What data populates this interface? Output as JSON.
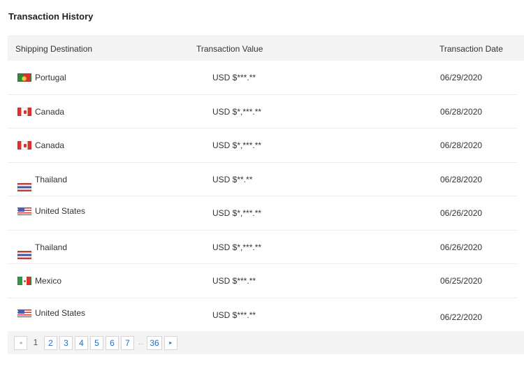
{
  "title": "Transaction History",
  "table": {
    "columns": {
      "destination": "Shipping Destination",
      "value": "Transaction Value",
      "date": "Transaction Date"
    },
    "rows": [
      {
        "flag_icon": "portugal-flag-icon",
        "destination": "Portugal",
        "value": "USD $***.**",
        "date": "06/29/2020"
      },
      {
        "flag_icon": "canada-flag-icon",
        "destination": "Canada",
        "value": "USD $*,***.**",
        "date": "06/28/2020"
      },
      {
        "flag_icon": "canada-flag-icon",
        "destination": "Canada",
        "value": "USD $*,***.**",
        "date": "06/28/2020"
      },
      {
        "flag_icon": "thailand-flag-icon",
        "destination": "Thailand",
        "value": "USD $**.**",
        "date": "06/28/2020"
      },
      {
        "flag_icon": "united-states-flag-icon",
        "destination": "United States",
        "value": "USD $*,***.**",
        "date": "06/26/2020"
      },
      {
        "flag_icon": "thailand-flag-icon",
        "destination": "Thailand",
        "value": "USD $*,***.**",
        "date": "06/26/2020"
      },
      {
        "flag_icon": "mexico-flag-icon",
        "destination": "Mexico",
        "value": "USD $***.**",
        "date": "06/25/2020"
      },
      {
        "flag_icon": "united-states-flag-icon",
        "destination": "United States",
        "value": "USD $***.**",
        "date": "06/22/2020"
      }
    ]
  },
  "pagination": {
    "prev_icon": "◂",
    "current": "1",
    "pages": [
      "2",
      "3",
      "4",
      "5",
      "6",
      "7"
    ],
    "ellipsis": "...",
    "last": "36",
    "next_icon": "▸"
  }
}
